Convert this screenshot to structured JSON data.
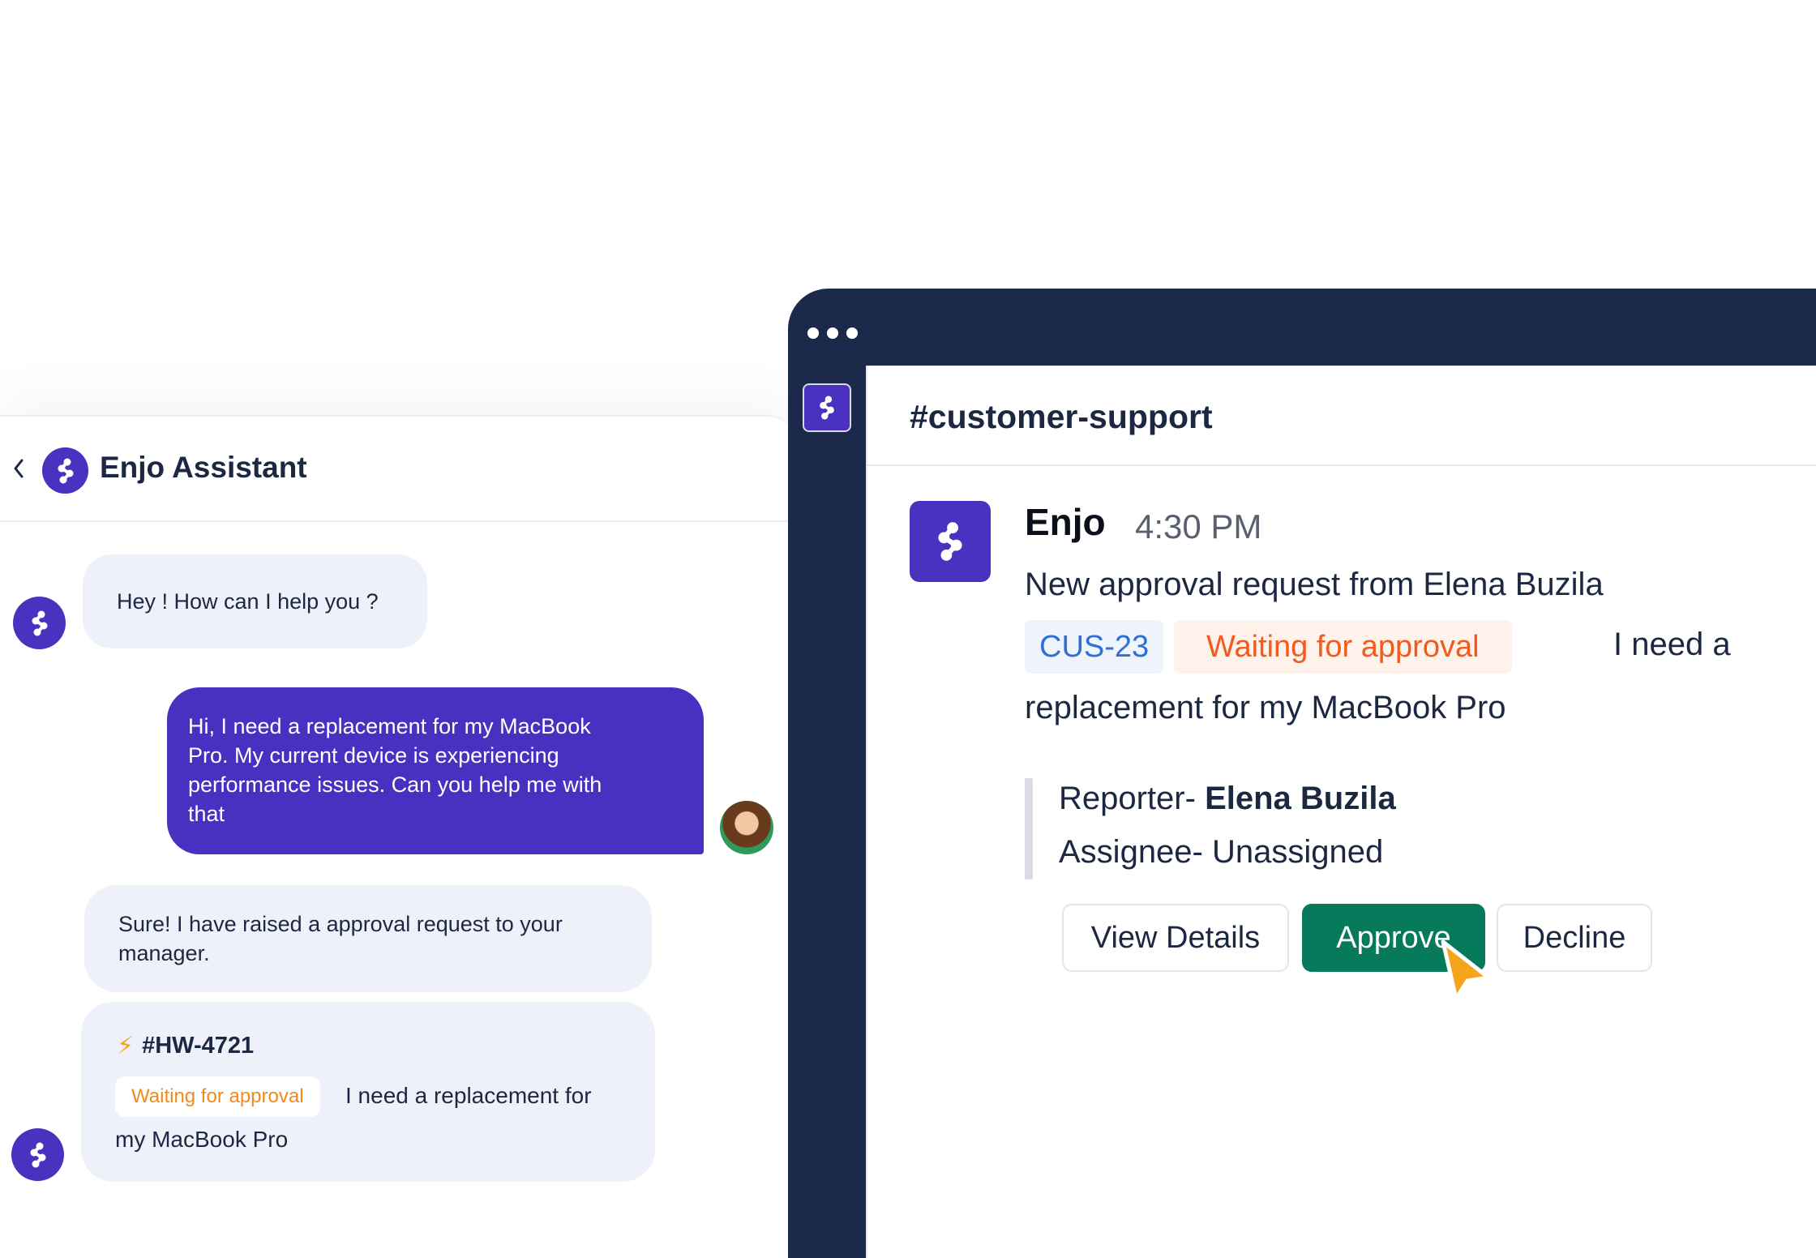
{
  "chat_widget": {
    "title": "Enjo Assistant",
    "messages": [
      {
        "from": "bot",
        "text": "Hey ! How can I help you ?"
      },
      {
        "from": "user",
        "lines": [
          "Hi, I need a replacement for my MacBook",
          "Pro. My current device is experiencing",
          "performance issues. Can you help me with",
          "that"
        ]
      },
      {
        "from": "bot",
        "lines": [
          "Sure! I have raised a approval request to your",
          "manager."
        ]
      }
    ],
    "ticket_card": {
      "id": "#HW-4721",
      "status": "Waiting for approval",
      "text_part1": "I need a replacement for",
      "text_part2": "my MacBook Pro"
    }
  },
  "app_window": {
    "channel": "#customer-support",
    "message": {
      "sender": "Enjo",
      "time": "4:30 PM",
      "line1": "New approval request from Elena Buzila",
      "ticket_id": "CUS-23",
      "status": "Waiting for approval",
      "text_part1": "I need a",
      "text_part2": "replacement for my MacBook Pro",
      "reporter_label": "Reporter-",
      "reporter_name": "Elena Buzila",
      "assignee": "Assignee- Unassigned"
    },
    "buttons": {
      "view_details": "View Details",
      "approve": "Approve",
      "decline": "Decline"
    }
  },
  "colors": {
    "brand_purple": "#4a31bf",
    "window_navy": "#1b2a4a",
    "approve_green": "#077a5c",
    "status_orange": "#f25a1f",
    "cursor_yellow": "#f5a51c"
  },
  "icons": [
    "chevron-left-icon",
    "enjo-logo-icon",
    "lightning-bolt-icon",
    "mouse-cursor-icon"
  ]
}
